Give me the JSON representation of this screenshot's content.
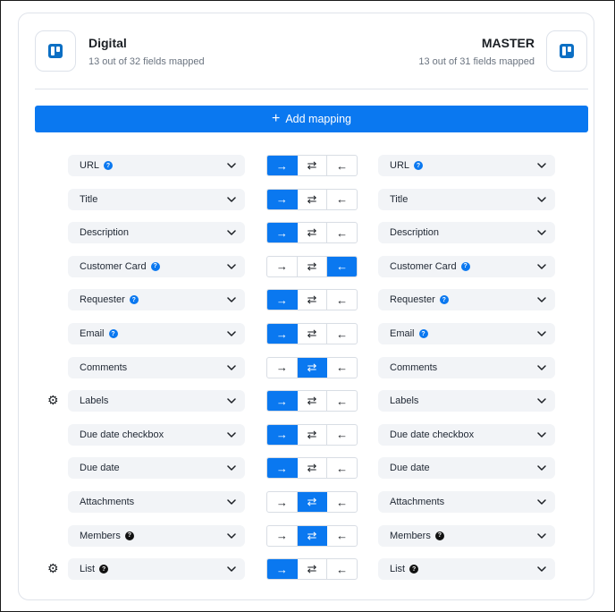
{
  "left_system": {
    "name": "Digital",
    "subtitle": "13 out of 32 fields mapped",
    "icon": "trello-icon"
  },
  "right_system": {
    "name": "MASTER",
    "subtitle": "13 out of 31 fields mapped",
    "icon": "trello-icon"
  },
  "add_mapping_label": "Add mapping",
  "direction_glyphs": {
    "to_right": "→",
    "both": "⇄",
    "to_left": "←"
  },
  "colors": {
    "accent": "#0a78f0",
    "help_dark": "#111111",
    "select_bg": "#f2f4f7"
  },
  "mappings": [
    {
      "left": "URL",
      "right": "URL",
      "help": "blue",
      "direction": "to_right",
      "gear": false
    },
    {
      "left": "Title",
      "right": "Title",
      "help": "",
      "direction": "to_right",
      "gear": false
    },
    {
      "left": "Description",
      "right": "Description",
      "help": "",
      "direction": "to_right",
      "gear": false
    },
    {
      "left": "Customer Card",
      "right": "Customer Card",
      "help": "blue",
      "direction": "to_left",
      "gear": false
    },
    {
      "left": "Requester",
      "right": "Requester",
      "help": "blue",
      "direction": "to_right",
      "gear": false
    },
    {
      "left": "Email",
      "right": "Email",
      "help": "blue",
      "direction": "to_right",
      "gear": false
    },
    {
      "left": "Comments",
      "right": "Comments",
      "help": "",
      "direction": "both",
      "gear": false
    },
    {
      "left": "Labels",
      "right": "Labels",
      "help": "",
      "direction": "to_right",
      "gear": true
    },
    {
      "left": "Due date checkbox",
      "right": "Due date checkbox",
      "help": "",
      "direction": "to_right",
      "gear": false
    },
    {
      "left": "Due date",
      "right": "Due date",
      "help": "",
      "direction": "to_right",
      "gear": false
    },
    {
      "left": "Attachments",
      "right": "Attachments",
      "help": "",
      "direction": "both",
      "gear": false
    },
    {
      "left": "Members",
      "right": "Members",
      "help": "dark",
      "direction": "both",
      "gear": false
    },
    {
      "left": "List",
      "right": "List",
      "help": "dark",
      "direction": "to_right",
      "gear": true
    }
  ]
}
